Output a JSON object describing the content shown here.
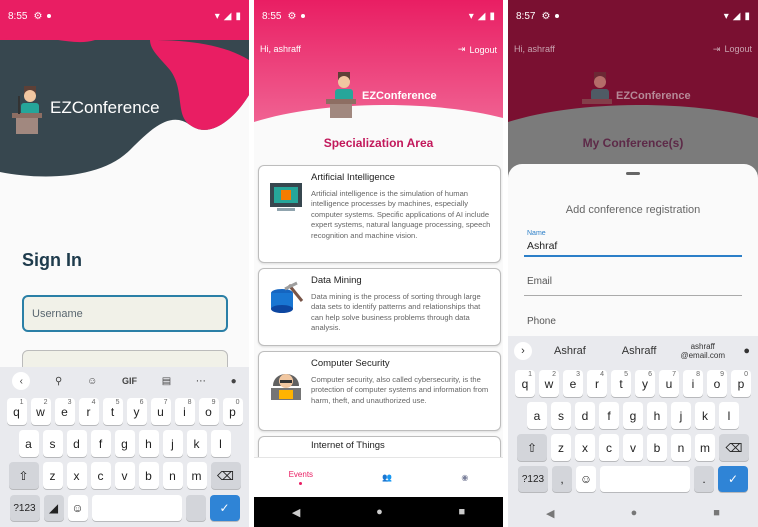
{
  "screen1": {
    "status_time": "8:55",
    "brand": "EZConference",
    "sign_in_title": "Sign In",
    "username_placeholder": "Username",
    "keyboard": {
      "toolbar": [
        "GIF"
      ],
      "row1": [
        "q",
        "w",
        "e",
        "r",
        "t",
        "y",
        "u",
        "i",
        "o",
        "p"
      ],
      "row1_nums": [
        "1",
        "2",
        "3",
        "4",
        "5",
        "6",
        "7",
        "8",
        "9",
        "0"
      ],
      "row2": [
        "a",
        "s",
        "d",
        "f",
        "g",
        "h",
        "j",
        "k",
        "l"
      ],
      "row3": [
        "z",
        "x",
        "c",
        "v",
        "b",
        "n",
        "m"
      ],
      "sym_key": "?123"
    }
  },
  "screen2": {
    "status_time": "8:55",
    "greeting": "Hi, ashraff",
    "logout_label": "Logout",
    "brand": "EZConference",
    "section_title": "Specialization Area",
    "cards": [
      {
        "title": "Artificial Intelligence",
        "description": "Artificial intelligence is the simulation of human intelligence processes by machines, especially computer systems. Specific applications of AI include expert systems, natural language processing, speech recognition and machine vision.",
        "icon": "ai-chip-icon"
      },
      {
        "title": "Data Mining",
        "description": "Data mining is the process of sorting through large data sets to identify patterns and relationships that can help solve business problems through data analysis.",
        "icon": "database-pickaxe-icon"
      },
      {
        "title": "Computer Security",
        "description": "Computer security, also called cybersecurity, is the protection of computer systems and information from harm, theft, and unauthorized use.",
        "icon": "hacker-icon"
      },
      {
        "title": "Internet of Things",
        "description": "",
        "icon": "iot-icon"
      }
    ],
    "nav": {
      "events_label": "Events"
    }
  },
  "screen3": {
    "status_time": "8:57",
    "greeting": "Hi, ashraff",
    "logout_label": "Logout",
    "brand": "EZConference",
    "section_title": "My Conference(s)",
    "sheet_title": "Add conference registration",
    "name_label": "Name",
    "name_value": "Ashraf",
    "email_label": "Email",
    "phone_label": "Phone",
    "suggestions": [
      "Ashraf",
      "Ashraff"
    ],
    "suggestion_email_name": "ashraff",
    "suggestion_email_domain": "@email.com",
    "keyboard": {
      "row1": [
        "q",
        "w",
        "e",
        "r",
        "t",
        "y",
        "u",
        "i",
        "o",
        "p"
      ],
      "row1_nums": [
        "1",
        "2",
        "3",
        "4",
        "5",
        "6",
        "7",
        "8",
        "9",
        "0"
      ],
      "row2": [
        "a",
        "s",
        "d",
        "f",
        "g",
        "h",
        "j",
        "k",
        "l"
      ],
      "row3": [
        "z",
        "x",
        "c",
        "v",
        "b",
        "n",
        "m"
      ],
      "sym_key": "?123",
      "comma_key": ",",
      "period_key": "."
    }
  },
  "colors": {
    "primary": "#e91e63",
    "dark": "#37474f",
    "accent_blue": "#2f84d6",
    "title_pink": "#c2185b"
  }
}
